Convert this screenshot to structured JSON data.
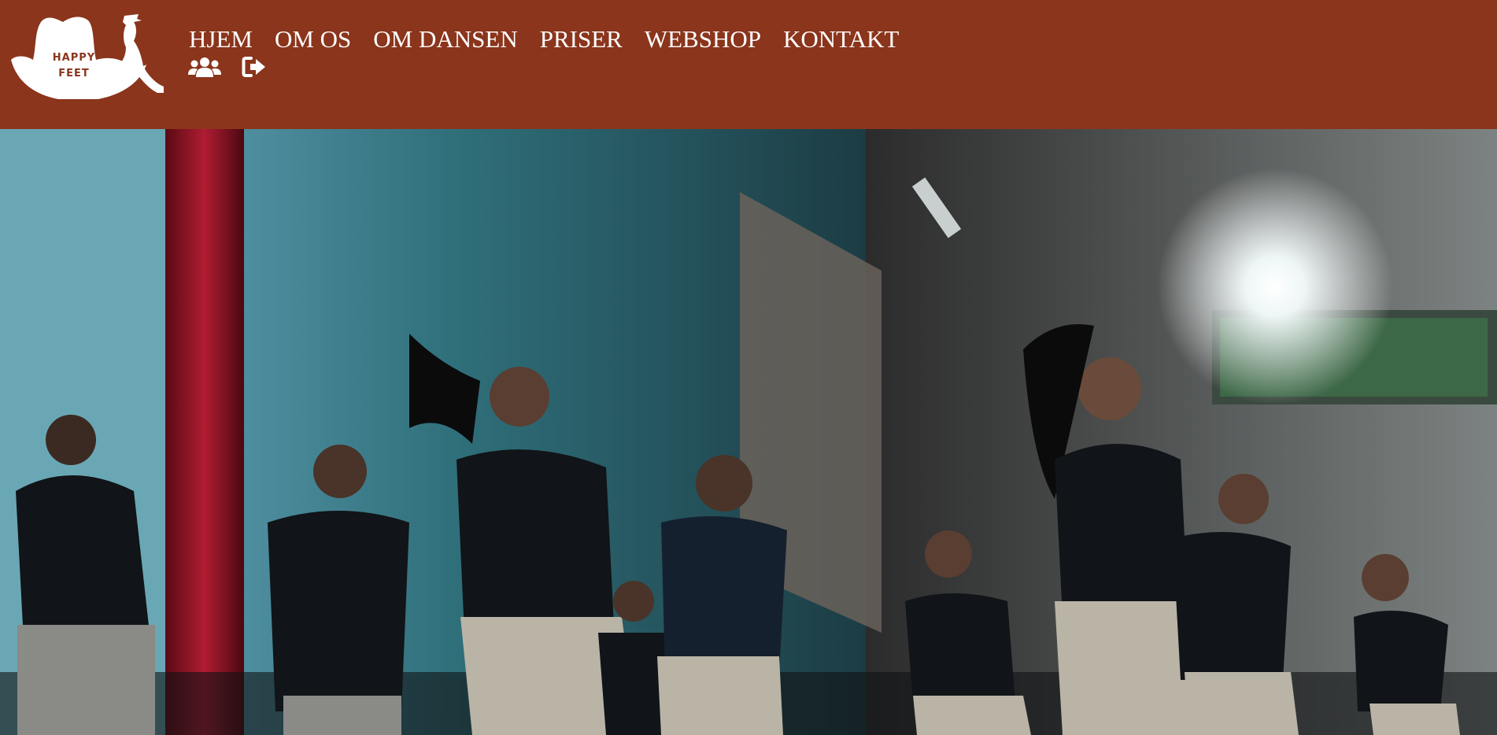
{
  "logo": {
    "line1": "HAPPY",
    "line2": "FEET",
    "icon": "cowboy-hat-logo"
  },
  "nav": {
    "items": [
      {
        "label": "HJEM"
      },
      {
        "label": "OM OS"
      },
      {
        "label": "OM DANSEN"
      },
      {
        "label": "PRISER"
      },
      {
        "label": "WEBSHOP"
      },
      {
        "label": "KONTAKT"
      }
    ]
  },
  "icons": {
    "members": "users-icon",
    "logout": "sign-out-icon"
  },
  "hero": {
    "image": "dancers-on-stage-photo"
  },
  "colors": {
    "header": "#8a351c",
    "text": "#ffffff"
  }
}
